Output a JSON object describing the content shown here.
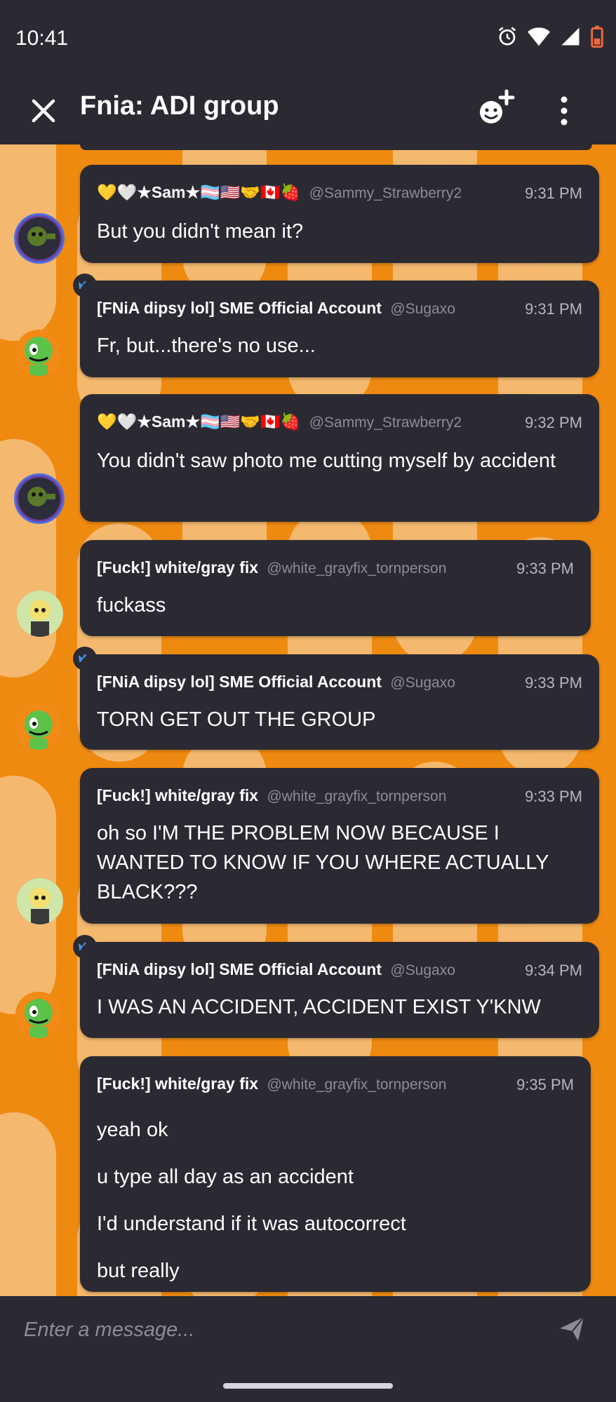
{
  "status_bar": {
    "time": "10:41"
  },
  "app_bar": {
    "title": "Fnia: ADI group",
    "close_icon": "close-icon",
    "invite_icon": "add-member-icon",
    "more_icon": "more-vertical-icon"
  },
  "colors": {
    "background": "#ef8a10",
    "pattern_light": "#f6c88e",
    "bubble": "#2b2a33",
    "text": "#ffffff",
    "muted": "#8d8b96",
    "crown": "#4a90e2"
  },
  "messages": [
    {
      "name": "💛🤍★Sam★🏳️‍⚧️🇺🇸🤝🇨🇦🍓",
      "handle": "@Sammy_Strawberry2",
      "time": "9:31 PM",
      "lines": [
        "But you didn't mean it?"
      ]
    },
    {
      "name": "[FNiA dipsy lol] SME Official Account",
      "handle": "@Sugaxo",
      "time": "9:31 PM",
      "lines": [
        "Fr, but...there's no use..."
      ]
    },
    {
      "name": "💛🤍★Sam★🏳️‍⚧️🇺🇸🤝🇨🇦🍓",
      "handle": "@Sammy_Strawberry2",
      "time": "9:32 PM",
      "lines": [
        "You didn't saw photo me cutting myself by accident"
      ]
    },
    {
      "name": "[Fuck!] white/gray fix",
      "handle": "@white_grayfix_tornperson",
      "time": "9:33 PM",
      "lines": [
        "fuckass"
      ]
    },
    {
      "name": "[FNiA dipsy lol] SME Official Account",
      "handle": "@Sugaxo",
      "time": "9:33 PM",
      "lines": [
        "TORN GET OUT THE GROUP"
      ]
    },
    {
      "name": "[Fuck!] white/gray fix",
      "handle": "@white_grayfix_tornperson",
      "time": "9:33 PM",
      "lines": [
        "oh so I'M THE PROBLEM NOW BECAUSE I WANTED TO KNOW IF YOU WHERE ACTUALLY BLACK???"
      ]
    },
    {
      "name": "[FNiA dipsy lol] SME Official Account",
      "handle": "@Sugaxo",
      "time": "9:34 PM",
      "lines": [
        "I WAS AN ACCIDENT, ACCIDENT EXIST Y'KNW"
      ]
    },
    {
      "name": "[Fuck!] white/gray fix",
      "handle": "@white_grayfix_tornperson",
      "time": "9:35 PM",
      "lines": [
        "yeah ok",
        "u type all day as an accident",
        "I'd understand if it was autocorrect",
        "but really"
      ]
    }
  ],
  "input": {
    "placeholder": "Enter a message...",
    "send_icon": "send-icon"
  }
}
